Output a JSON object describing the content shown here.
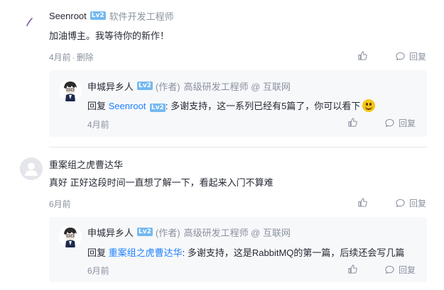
{
  "comments": [
    {
      "user": "Seenroot",
      "level": "Lv2",
      "role": "软件开发工程师",
      "content": "加油博主。我等待你的新作！",
      "time": "4月前",
      "separator": "·",
      "delete_label": "删除",
      "reply_label": "回复",
      "replies": [
        {
          "user": "申城异乡人",
          "level": "Lv2",
          "author_tag": "(作者)",
          "role": "高级研发工程师 @ 互联网",
          "reply_prefix": "回复",
          "reply_to": "Seenroot",
          "reply_to_level": "Lv2",
          "content": ": 多谢支持，这一系列已经有5篇了，你可以看下",
          "emoji": "smile-emoji",
          "time": "4月前",
          "reply_label": "回复"
        }
      ]
    },
    {
      "user": "重案组之虎曹达华",
      "content": "真好 正好这段时间一直想了解一下，看起来入门不算难",
      "time": "6月前",
      "reply_label": "回复",
      "replies": [
        {
          "user": "申城异乡人",
          "level": "Lv2",
          "author_tag": "(作者)",
          "role": "高级研发工程师 @ 互联网",
          "reply_prefix": "回复",
          "reply_to": "重案组之虎曹达华",
          "content": ": 多谢支持，这是RabbitMQ的第一篇，后续还会写几篇",
          "time": "6月前",
          "reply_label": "回复"
        }
      ]
    }
  ],
  "colors": {
    "link": "#1e80ff",
    "muted": "#8a919f",
    "level_badge": "#74b9f0",
    "reply_bg": "#f7f8fa"
  }
}
